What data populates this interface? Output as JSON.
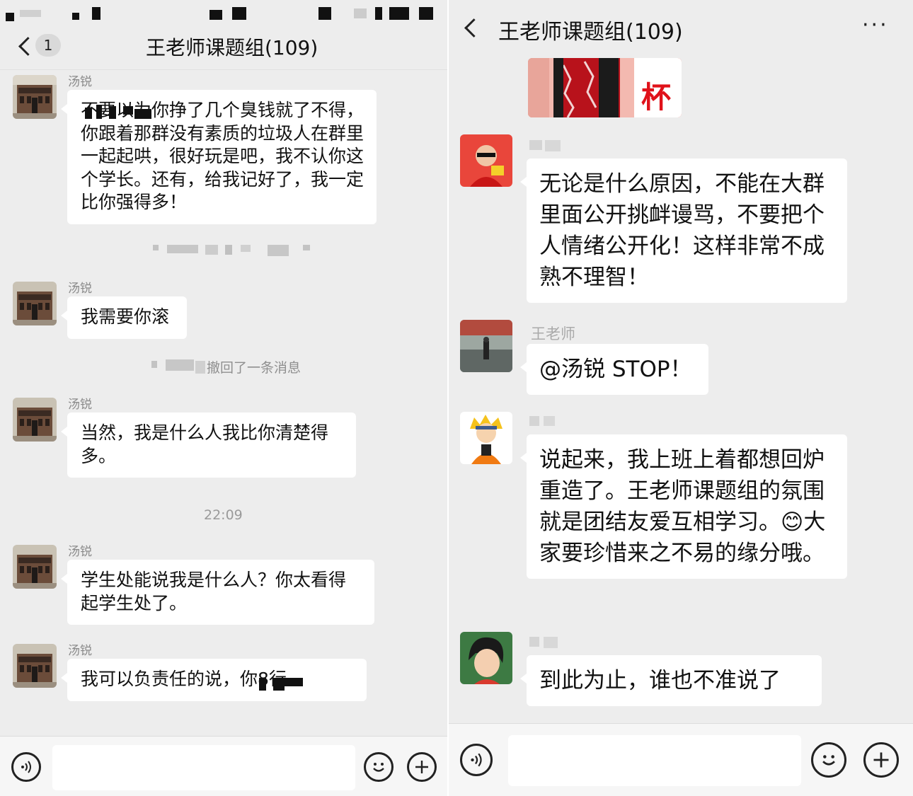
{
  "left": {
    "header": {
      "unread_badge": "1",
      "title": "王老师课题组(109)"
    },
    "messages": [
      {
        "sender": "汤锐",
        "text": "不要以为你挣了几个臭钱就了不得，你跟着那群没有素质的垃圾人在群里一起起哄，很好玩是吧，我不认你这个学长。还有，给我记好了，我一定比你强得多！"
      },
      {
        "sender": "汤锐",
        "text": "我需要你滚"
      },
      {
        "system": "撤回了一条消息"
      },
      {
        "sender": "汤锐",
        "text": "当然，我是什么人我比你清楚得多。"
      },
      {
        "timestamp": "22:09"
      },
      {
        "sender": "汤锐",
        "text": "学生处能说我是什么人？你太看得起学生处了。"
      },
      {
        "sender": "汤锐",
        "text": "我可以负责任的说，你8行。"
      }
    ]
  },
  "right": {
    "header": {
      "title": "王老师课题组(109)",
      "more": "···"
    },
    "image_caption": "杯",
    "messages": [
      {
        "sender": "",
        "text": "无论是什么原因，不能在大群里面公开挑衅谩骂，不要把个人情绪公开化！这样非常不成熟不理智！"
      },
      {
        "sender": "王老师",
        "text": "@汤锐 STOP！"
      },
      {
        "sender": "",
        "text": "说起来，我上班上着都想回炉重造了。王老师课题组的氛围就是团结友爱互相学习。😊大家要珍惜来之不易的缘分哦。"
      },
      {
        "sender": "",
        "text": "到此为止，谁也不准说了"
      }
    ]
  },
  "colors": {
    "background": "#ededed",
    "bubble": "#ffffff",
    "sender": "#8a8a8a"
  }
}
